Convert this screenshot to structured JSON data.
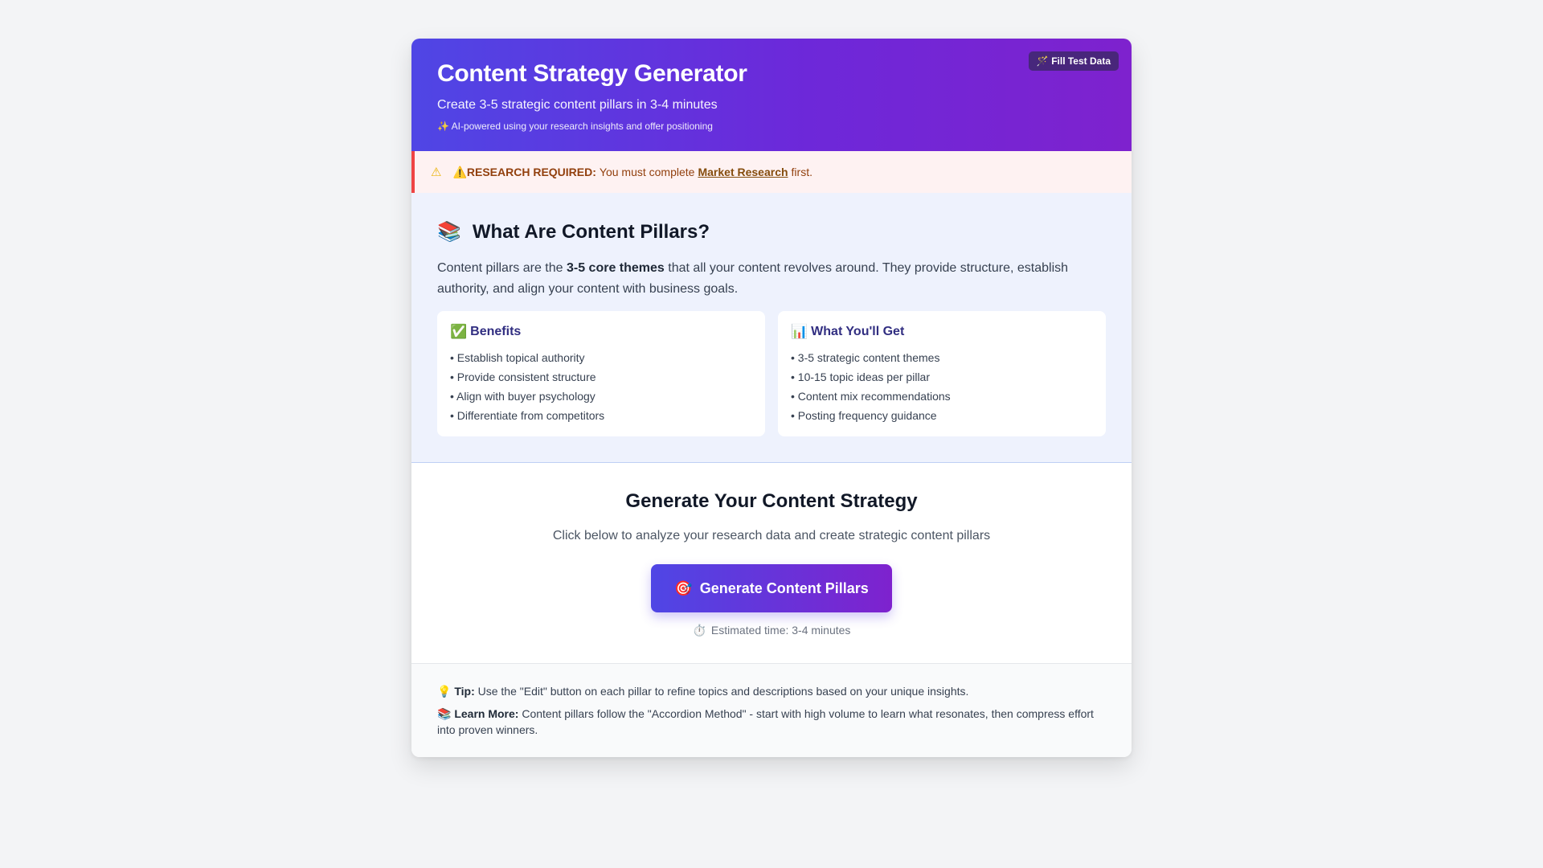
{
  "header": {
    "title": "Content Strategy Generator",
    "subtitle": "Create 3-5 strategic content pillars in 3-4 minutes",
    "note_icon": "✨",
    "note": "AI-powered using your research insights and offer positioning",
    "fill_button_icon": "🪄",
    "fill_button": "Fill Test Data"
  },
  "alert": {
    "icon": "⚠",
    "label_icon": "⚠️",
    "label": "RESEARCH REQUIRED:",
    "text_before": "You must complete",
    "link": "Market Research",
    "text_after": "first."
  },
  "pillars": {
    "icon": "📚",
    "title": "What Are Content Pillars?",
    "desc_before": "Content pillars are the",
    "desc_bold": "3-5 core themes",
    "desc_after": "that all your content revolves around. They provide structure, establish authority, and align your content with business goals.",
    "benefits": {
      "icon": "✅",
      "title": "Benefits",
      "items": [
        "• Establish topical authority",
        "• Provide consistent structure",
        "• Align with buyer psychology",
        "• Differentiate from competitors"
      ]
    },
    "get": {
      "icon": "📊",
      "title": "What You'll Get",
      "items": [
        "• 3-5 strategic content themes",
        "• 10-15 topic ideas per pillar",
        "• Content mix recommendations",
        "• Posting frequency guidance"
      ]
    }
  },
  "generate": {
    "title": "Generate Your Content Strategy",
    "desc": "Click below to analyze your research data and create strategic content pillars",
    "button_icon": "🎯",
    "button": "Generate Content Pillars",
    "est_icon": "⏱️",
    "est": "Estimated time: 3-4 minutes"
  },
  "tips": {
    "tip_icon": "💡",
    "tip_label": "Tip:",
    "tip_text": "Use the \"Edit\" button on each pillar to refine topics and descriptions based on your unique insights.",
    "learn_icon": "📚",
    "learn_label": "Learn More:",
    "learn_text": "Content pillars follow the \"Accordion Method\" - start with high volume to learn what resonates, then compress effort into proven winners."
  }
}
